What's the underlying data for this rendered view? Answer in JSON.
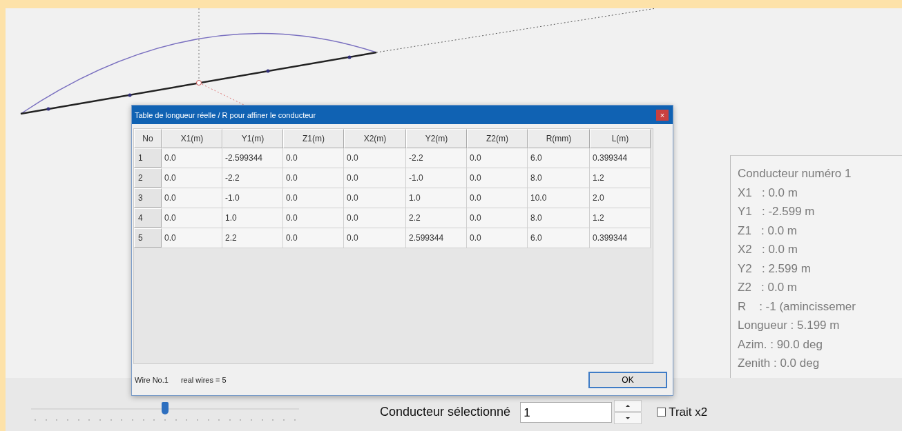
{
  "dialog": {
    "title": "Table de longueur réelle / R pour affiner le conducteur",
    "close": "×",
    "columns": [
      "No",
      "X1(m)",
      "Y1(m)",
      "Z1(m)",
      "X2(m)",
      "Y2(m)",
      "Z2(m)",
      "R(mm)",
      "L(m)"
    ],
    "rows": [
      {
        "no": "1",
        "cells": [
          "0.0",
          "-2.599344",
          "0.0",
          "0.0",
          "-2.2",
          "0.0",
          "6.0",
          "0.399344"
        ]
      },
      {
        "no": "2",
        "cells": [
          "0.0",
          "-2.2",
          "0.0",
          "0.0",
          "-1.0",
          "0.0",
          "8.0",
          "1.2"
        ]
      },
      {
        "no": "3",
        "cells": [
          "0.0",
          "-1.0",
          "0.0",
          "0.0",
          "1.0",
          "0.0",
          "10.0",
          "2.0"
        ]
      },
      {
        "no": "4",
        "cells": [
          "0.0",
          "1.0",
          "0.0",
          "0.0",
          "2.2",
          "0.0",
          "8.0",
          "1.2"
        ]
      },
      {
        "no": "5",
        "cells": [
          "0.0",
          "2.2",
          "0.0",
          "0.0",
          "2.599344",
          "0.0",
          "6.0",
          "0.399344"
        ]
      }
    ],
    "status": [
      "Wire No.1",
      "real wires = 5"
    ],
    "ok_button": "OK"
  },
  "info_panel": {
    "lines": [
      "Conducteur numéro 1",
      "X1   : 0.0 m",
      "Y1   : -2.599 m",
      "Z1   : 0.0 m",
      "X2   : 0.0 m",
      "Y2   : 2.599 m",
      "Z2   : 0.0 m",
      "R    : -1 (amincissemer",
      "Longueur : 5.199 m",
      "Azim. : 90.0 deg",
      "Zenith : 0.0 deg"
    ]
  },
  "zoom_slider": {
    "level": 0.5
  },
  "selector": {
    "label": "Conducteur sélectionné",
    "value": "1"
  },
  "trait_checkbox": {
    "label": "Trait x2",
    "checked": false
  }
}
